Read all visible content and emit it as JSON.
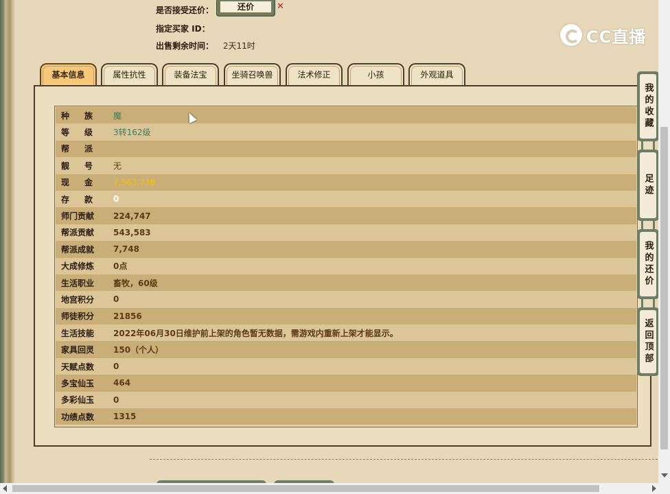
{
  "header": {
    "accept_counter_label": "是否接受还价：",
    "counter_button_label": "还价",
    "close_icon_glyph": "✕",
    "buyer_id_label": "指定买家 ID：",
    "buyer_id_value": "",
    "remaining_label": "出售剩余时间：",
    "remaining_value": "2天11时"
  },
  "logo": {
    "text": "CC直播",
    "icon": "cc-logo-icon"
  },
  "tabs": [
    {
      "label": "基本信息",
      "active": true
    },
    {
      "label": "属性抗性",
      "active": false
    },
    {
      "label": "装备法宝",
      "active": false
    },
    {
      "label": "坐骑召唤兽",
      "active": false
    },
    {
      "label": "法术修正",
      "active": false
    },
    {
      "label": "小孩",
      "active": false
    },
    {
      "label": "外观道具",
      "active": false
    }
  ],
  "info_rows": [
    {
      "label": "种族",
      "value": "魔"
    },
    {
      "label": "等级",
      "value": "3转162级"
    },
    {
      "label": "帮派",
      "value": ""
    },
    {
      "label": "靓号",
      "value": "无"
    },
    {
      "label": "现金",
      "value": "7,563,738"
    },
    {
      "label": "存款",
      "value": "0"
    },
    {
      "label": "师门贡献",
      "value": "224,747"
    },
    {
      "label": "帮派贡献",
      "value": "543,583"
    },
    {
      "label": "帮派成就",
      "value": "7,748"
    },
    {
      "label": "大成修炼",
      "value": "0点"
    },
    {
      "label": "生活职业",
      "value": "畜牧，60级"
    },
    {
      "label": "地宫积分",
      "value": "0"
    },
    {
      "label": "师徒积分",
      "value": "21856"
    },
    {
      "label": "生活技能",
      "value": "2022年06月30日维护前上架的角色暂无数据，需游戏内重新上架才能显示。"
    },
    {
      "label": "家具回灵",
      "value": "150（个人）"
    },
    {
      "label": "天赋点数",
      "value": "0"
    },
    {
      "label": "多宝仙玉",
      "value": "464"
    },
    {
      "label": "多彩仙玉",
      "value": "0"
    },
    {
      "label": "功绩点数",
      "value": "1315"
    }
  ],
  "side_buttons": [
    {
      "label": "我的收藏"
    },
    {
      "label": "足迹"
    },
    {
      "label": "我的还价"
    },
    {
      "label": "返回顶部"
    }
  ],
  "colors": {
    "tab_active": "#f6c877",
    "row_dark": "#c9ae78",
    "row_light": "#dcc596",
    "cash_gold": "#f5c400",
    "green_text": "#3e7a5a",
    "close_red": "#c0201b"
  }
}
